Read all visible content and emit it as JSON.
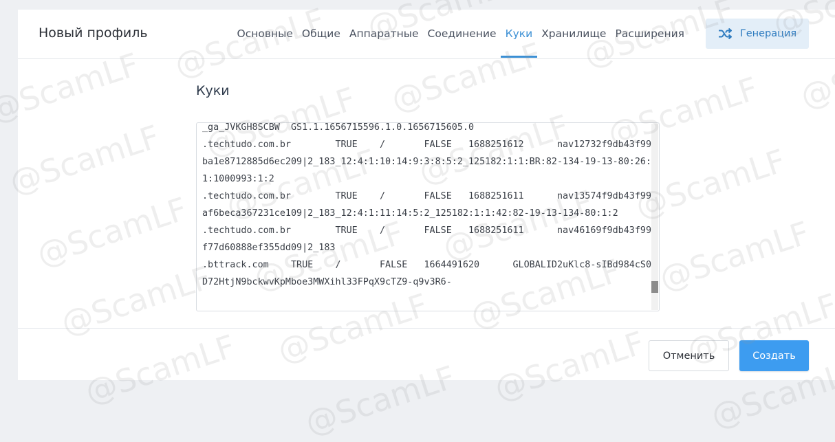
{
  "header": {
    "title": "Новый профиль",
    "tabs": [
      {
        "label": "Основные",
        "active": false
      },
      {
        "label": "Общие",
        "active": false
      },
      {
        "label": "Аппаратные",
        "active": false
      },
      {
        "label": "Соединение",
        "active": false
      },
      {
        "label": "Куки",
        "active": true
      },
      {
        "label": "Хранилище",
        "active": false
      },
      {
        "label": "Расширения",
        "active": false
      }
    ],
    "generate_label": "Генерация",
    "generate_icon": "shuffle-icon"
  },
  "cookies": {
    "title": "Куки",
    "content": "_ga_JVKGH8SCBW  GS1.1.1656715596.1.0.1656715605.0\n.techtudo.com.br        TRUE    /       FALSE   1688251612      nav12732f9db43f99ba1e8712885d6ec209|2_183_12:4:1:10:14:9:3:8:5:2_125182:1:1:BR:82-134-19-13-80:26:1:1000993:1:2\n.techtudo.com.br        TRUE    /       FALSE   1688251611      nav13574f9db43f99af6beca367231ce109|2_183_12:4:1:11:14:5:2_125182:1:1:42:82-19-13-134-80:1:2\n.techtudo.com.br        TRUE    /       FALSE   1688251611      nav46169f9db43f99f77d60888ef355dd09|2_183\n.bttrack.com    TRUE    /       FALSE   1664491620      GLOBALID2uKlc8-sIBd984cS0D72HtjN9bckwvKpMboe3MWXihl33FPqX9cTZ9-q9v3R6-"
  },
  "footer": {
    "cancel_label": "Отменить",
    "create_label": "Создать"
  },
  "watermark": "@ScamLF",
  "colors": {
    "accent": "#3b8fd4",
    "create_button": "#3d9cf0",
    "generate_bg": "#e3eef8"
  }
}
